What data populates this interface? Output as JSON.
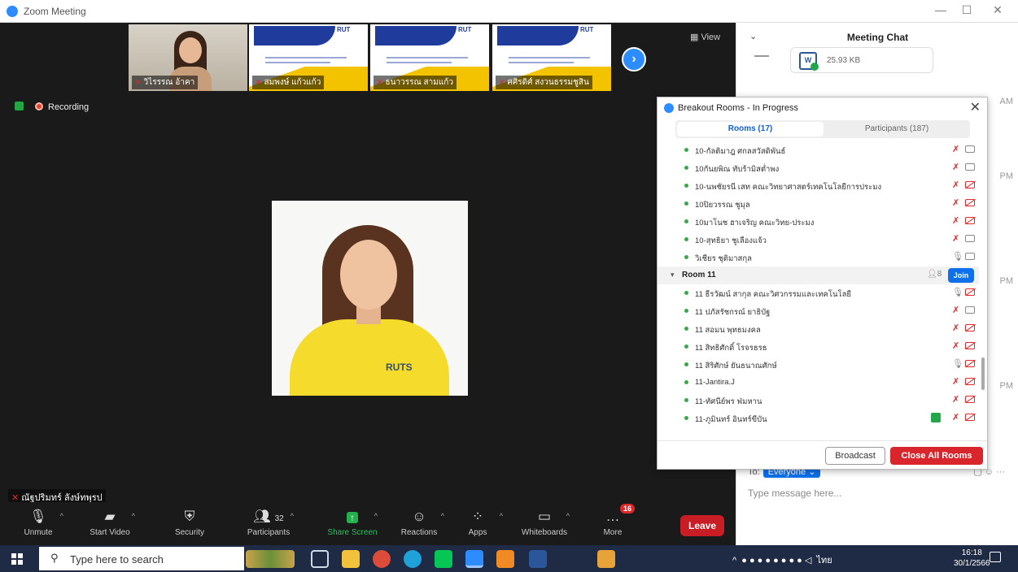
{
  "window": {
    "title": "Zoom Meeting"
  },
  "gallery": [
    {
      "name": "วิไรรรณ อ้าคา"
    },
    {
      "name": "สมพงษ์ แก้วแก้ว"
    },
    {
      "name": "ธนาวรรณ สามแก้ว"
    },
    {
      "name": "ศศิรดิศ์ สงวนธรรมชูสิน"
    }
  ],
  "view_label": "View",
  "recording_label": "Recording",
  "slide_brand": "RUT",
  "speaker_logo": "RUTS",
  "self_name": "ณัฐปริมทร์ ลังษ์ทพุรป",
  "toolbar": {
    "unmute": "Unmute",
    "start_video": "Start Video",
    "security": "Security",
    "participants": "Participants",
    "participants_count": "32",
    "share_screen": "Share Screen",
    "reactions": "Reactions",
    "apps": "Apps",
    "whiteboards": "Whiteboards",
    "more": "More",
    "more_badge": "16",
    "leave": "Leave"
  },
  "chat": {
    "title": "Meeting Chat",
    "file_size": "25.93 KB",
    "timestamps": [
      "AM",
      "PM",
      "PM",
      "PM"
    ],
    "to_label": "To:",
    "to_value": "Everyone",
    "input_placeholder": "Type message here..."
  },
  "breakout": {
    "title": "Breakout Rooms - In Progress",
    "tab_rooms": "Rooms (17)",
    "tab_participants": "Participants (187)",
    "rows_before": [
      {
        "name": "10-กัลติมาฎ ศกลสวัสดิพันธ์",
        "mic": "off",
        "cam": "on"
      },
      {
        "name": "10กันยพิณ ทับร้ามิสต่ำพง",
        "mic": "off",
        "cam": "on"
      },
      {
        "name": "10-นพชัยรนี เสท คณะวิทยาศาสตร์เทคโนโลยีการประมง",
        "mic": "off",
        "cam": "off"
      },
      {
        "name": "10ปิยวรรณ ชูมุล",
        "mic": "off",
        "cam": "off"
      },
      {
        "name": "10มาโนช ฮาเจริญ คณะวิทย-ประมง",
        "mic": "off",
        "cam": "off"
      },
      {
        "name": "10-สุทธิยา ชูเลืองแจ้ว",
        "mic": "off",
        "cam": "on"
      },
      {
        "name": "วิเชียร ชุติมาสกุล",
        "mic": "on",
        "cam": "on"
      }
    ],
    "room": {
      "name": "Room 11",
      "count": "8",
      "join": "Join"
    },
    "rows_after": [
      {
        "name": "11 ธีรวัฒน์ สากุล คณะวิศวกรรมและเทคโนโลยี",
        "mic": "on",
        "cam": "off"
      },
      {
        "name": "11 ปภัสรัชกรณ์ ยาธิบัฐ",
        "mic": "off",
        "cam": "on"
      },
      {
        "name": "11 สอมน พุทธมงคล",
        "mic": "off",
        "cam": "off"
      },
      {
        "name": "11 สิทธิศักดิ์ โรจรธรธ",
        "mic": "off",
        "cam": "off"
      },
      {
        "name": "11 สิริศักษ์ ยันธนาณศักษ์",
        "mic": "on",
        "cam": "off"
      },
      {
        "name": "11-Jantira.J",
        "mic": "off",
        "cam": "off"
      },
      {
        "name": "11-ทัศนีย์พร ฟ่มหาน",
        "mic": "off",
        "cam": "off"
      },
      {
        "name": "11-ภูมินทร์ อินทร์ขีบัน",
        "mic": "off",
        "cam": "off",
        "share": true
      }
    ],
    "broadcast": "Broadcast",
    "close_all": "Close All Rooms"
  },
  "taskbar": {
    "search_placeholder": "Type here to search",
    "lang": "ไทย",
    "time": "16:18",
    "date": "30/1/2566"
  }
}
